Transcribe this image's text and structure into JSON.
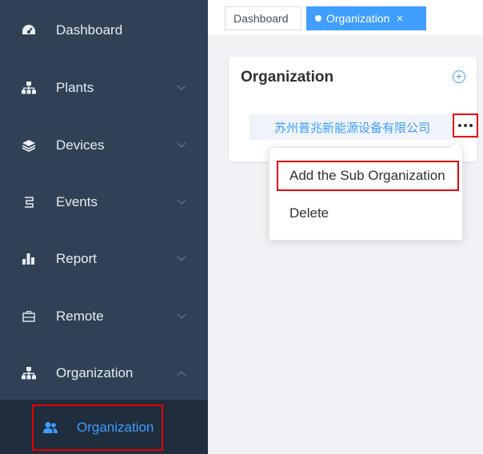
{
  "sidebar": {
    "items": [
      {
        "label": "Dashboard",
        "icon": "dashboard-icon",
        "has_arrow": false
      },
      {
        "label": "Plants",
        "icon": "sitemap-icon",
        "has_arrow": true
      },
      {
        "label": "Devices",
        "icon": "layers-icon",
        "has_arrow": true
      },
      {
        "label": "Events",
        "icon": "events-icon",
        "has_arrow": true
      },
      {
        "label": "Report",
        "icon": "bar-chart-icon",
        "has_arrow": true
      },
      {
        "label": "Remote",
        "icon": "remote-icon",
        "has_arrow": true
      },
      {
        "label": "Organization",
        "icon": "sitemap-icon",
        "has_arrow": true,
        "expanded": true
      }
    ],
    "sub_item": {
      "label": "Organization",
      "icon": "users-icon"
    }
  },
  "tags": [
    {
      "label": "Dashboard",
      "active": false
    },
    {
      "label": "Organization",
      "active": true
    }
  ],
  "card": {
    "title": "Organization",
    "node_label": "苏州普兆新能源设备有限公司"
  },
  "dropdown": {
    "items": [
      "Add the Sub Organization",
      "Delete"
    ]
  },
  "colors": {
    "sidebar_bg": "#304156",
    "submenu_bg": "#1f2d3d",
    "accent": "#409eff",
    "highlight_border": "#e60000"
  }
}
